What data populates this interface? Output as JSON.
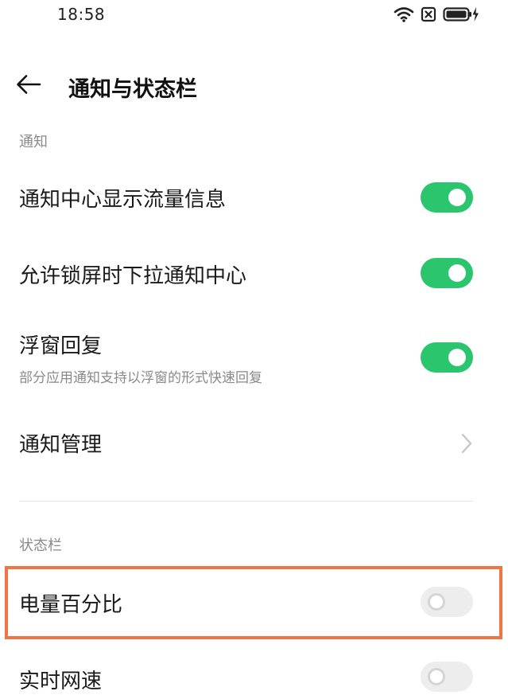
{
  "status_bar": {
    "time": "18:58",
    "icons": [
      "wifi-icon",
      "no-sim-icon",
      "battery-charging-icon"
    ]
  },
  "header": {
    "back_icon": "arrow-left-icon",
    "title": "通知与状态栏"
  },
  "sections": {
    "notification": {
      "label": "通知",
      "items": [
        {
          "title": "通知中心显示流量信息",
          "control": "toggle",
          "state": "on"
        },
        {
          "title": "允许锁屏时下拉通知中心",
          "control": "toggle",
          "state": "on"
        },
        {
          "title": "浮窗回复",
          "subtitle": "部分应用通知支持以浮窗的形式快速回复",
          "control": "toggle",
          "state": "on"
        },
        {
          "title": "通知管理",
          "control": "chevron"
        }
      ]
    },
    "status_bar": {
      "label": "状态栏",
      "items": [
        {
          "title": "电量百分比",
          "control": "toggle",
          "state": "off",
          "highlighted": true
        },
        {
          "title": "实时网速",
          "control": "toggle",
          "state": "off"
        }
      ]
    }
  },
  "colors": {
    "toggle_on": "#2ac56c",
    "toggle_off": "#ededed",
    "highlight_border": "#ef7644",
    "section_label": "#8a8a8a"
  }
}
